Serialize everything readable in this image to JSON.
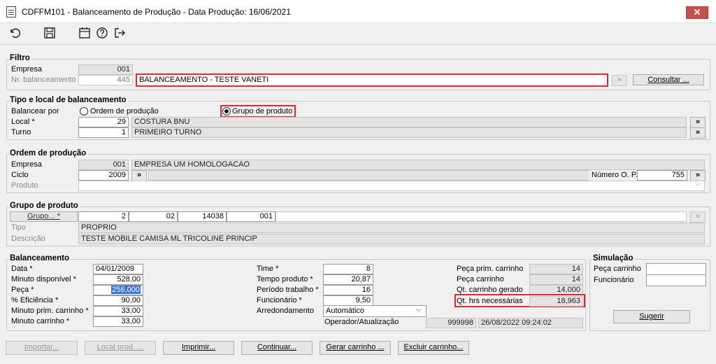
{
  "window": {
    "title": "CDFFM101 - Balanceamento de Produção - Data Produção:  16/06/2021",
    "close_glyph": "✕"
  },
  "toolbar": {
    "icons": [
      "undo-icon",
      "save-icon",
      "calendar-icon",
      "help-icon",
      "exit-icon"
    ]
  },
  "filtro": {
    "title": "Filtro",
    "empresa_label": "Empresa",
    "empresa_value": "001",
    "nr_label": "Nr. balanceamento",
    "nr_value": "445",
    "descricao_value": "BALANCEAMENTO - TESTE VANETI",
    "consultar_label": "Consultar ..."
  },
  "tipo": {
    "title": "Tipo e local de balanceamento",
    "balancear_label": "Balancear por",
    "radio_ordem": "Ordem de produção",
    "radio_grupo": "Grupo de produto",
    "selected": "grupo",
    "local_label": "Local *",
    "local_code": "29",
    "local_name": "COSTURA BNU",
    "turno_label": "Turno",
    "turno_code": "1",
    "turno_name": "PRIMEIRO TURNO"
  },
  "ordem": {
    "title": "Ordem de produção",
    "empresa_label": "Empresa",
    "empresa_code": "001",
    "empresa_name": "EMPRESA UM HOMOLOGACAO",
    "ciclo_label": "Ciclo",
    "ciclo_value": "2009",
    "numero_op_label": "Número O. P.",
    "numero_op_value": "755",
    "produto_label": "Produto"
  },
  "grupo": {
    "title": "Grupo de produto",
    "grupo_button": "Grupo... *",
    "grupo_values": [
      "2",
      "02",
      "14038",
      "001"
    ],
    "tipo_label": "Tipo",
    "tipo_value": "PROPRIO",
    "descricao_label": "Descrição",
    "descricao_value": "TESTE MOBILE CAMISA ML TRICOLINE PRINCIP"
  },
  "balanceamento": {
    "title": "Balanceamento",
    "data_label": "Data *",
    "data_value": "04/01/2009",
    "minuto_disp_label": "Minuto disponível *",
    "minuto_disp_value": "528,00",
    "peca_label": "Peça *",
    "peca_value": "256,000",
    "eficiencia_label": "% Eficiência *",
    "eficiencia_value": "90,00",
    "minuto_prim_label": "Minuto prim. carrinho *",
    "minuto_prim_value": "33,00",
    "minuto_carr_label": "Minuto carrinho *",
    "minuto_carr_value": "33,00",
    "time_label": "Time *",
    "time_value": "8",
    "tempo_label": "Tempo produto *",
    "tempo_value": "20,87",
    "periodo_label": "Período trabalho *",
    "periodo_value": "16",
    "funcionario_label": "Funcionário *",
    "funcionario_value": "9,50",
    "arredondamento_label": "Arredondamento",
    "arredondamento_value": "Automático",
    "operador_label": "Operador/Atualização",
    "operador_value": "999998",
    "atualizacao_value": "26/08/2022 09:24:02",
    "peca_prim_label": "Peça prim. carrinho",
    "peca_prim_value": "14",
    "peca_carr_label": "Peça carrinho",
    "peca_carr_value": "14",
    "qt_carr_label": "Qt. carrinho gerado",
    "qt_carr_value": "14,000",
    "qt_hrs_label": "Qt. hrs necessárias",
    "qt_hrs_value": "18,963"
  },
  "simulacao": {
    "title": "Simulação",
    "peca_label": "Peça carrinho",
    "funcionario_label": "Funcionário",
    "sugerir_label": "Sugerir"
  },
  "buttons": {
    "importar": "Importar...",
    "local_prod": "Local prod. ...",
    "imprimir": "Imprimir...",
    "continuar": "Continuar...",
    "gerar": "Gerar carrinho ...",
    "excluir": "Excluir carrinho..."
  },
  "colors": {
    "highlight_red": "#e0262e",
    "selection_blue": "#3a74d6"
  }
}
